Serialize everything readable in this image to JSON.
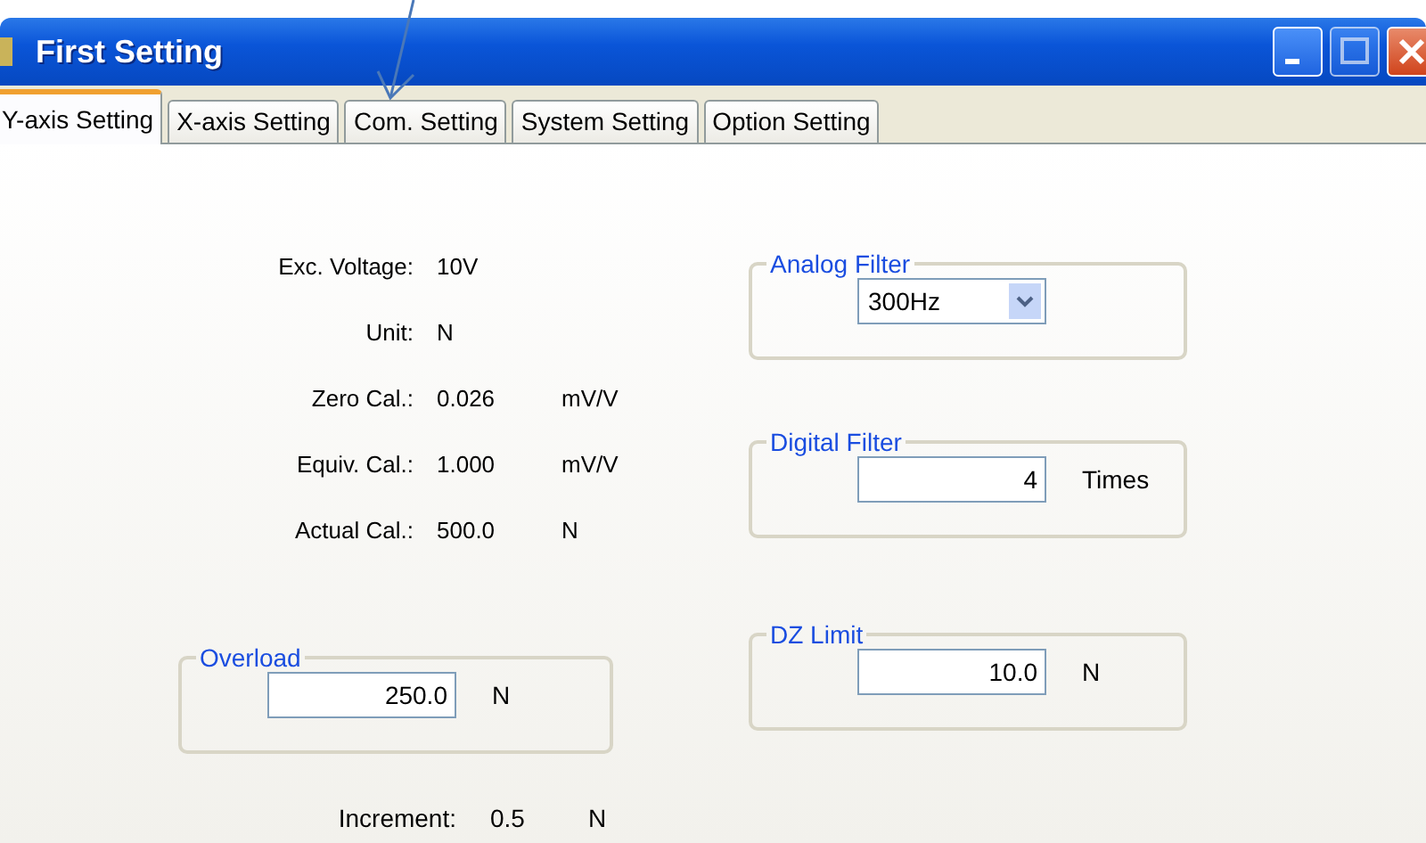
{
  "window": {
    "title": "First Setting"
  },
  "tabs": [
    {
      "label": "Y-axis Setting",
      "selected": true
    },
    {
      "label": "X-axis Setting",
      "selected": false
    },
    {
      "label": "Com. Setting",
      "selected": false
    },
    {
      "label": "System Setting",
      "selected": false
    },
    {
      "label": "Option Setting",
      "selected": false
    }
  ],
  "readings": [
    {
      "label": "Exc. Voltage:",
      "value": "10V"
    },
    {
      "label": "Unit:",
      "value": "N"
    },
    {
      "label": "Zero Cal.:",
      "value": "0.026",
      "unit": "mV/V"
    },
    {
      "label": "Equiv. Cal.:",
      "value": "1.000",
      "unit": "mV/V"
    },
    {
      "label": "Actual Cal.:",
      "value": "500.0",
      "unit": "N"
    }
  ],
  "left_groups": [
    {
      "title": "Overload",
      "kind": "input",
      "value": "250.0",
      "unit": "N"
    }
  ],
  "right_groups": [
    {
      "title": "Analog Filter",
      "kind": "dropdown",
      "value": "300Hz"
    },
    {
      "title": "Digital Filter",
      "kind": "input",
      "value": "4",
      "unit": "Times"
    },
    {
      "title": "DZ Limit",
      "kind": "input",
      "value": "10.0",
      "unit": "N"
    }
  ],
  "increment": {
    "label": "Increment:",
    "value": "0.5",
    "unit": "N"
  }
}
